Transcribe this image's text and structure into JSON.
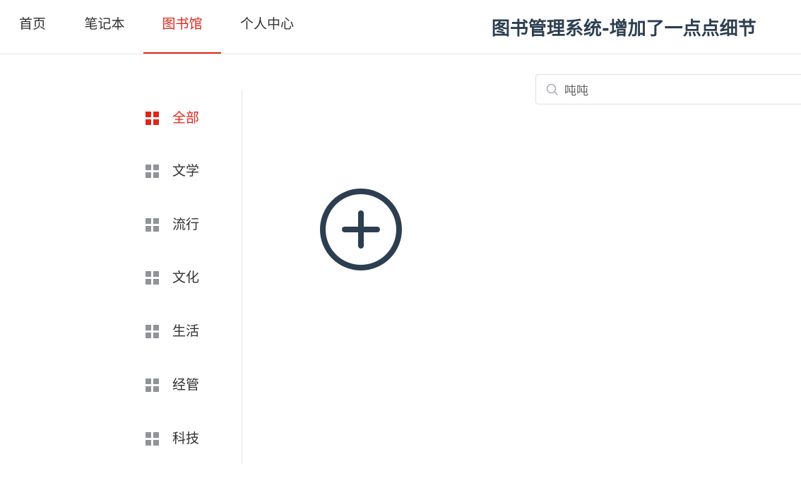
{
  "header": {
    "tabs": [
      {
        "label": "首页"
      },
      {
        "label": "笔记本"
      },
      {
        "label": "图书馆"
      },
      {
        "label": "个人中心"
      }
    ],
    "active_tab": "图书馆",
    "site_title": "图书管理系统-增加了一点点细节"
  },
  "search": {
    "value": "吨吨",
    "icon": "search-icon"
  },
  "sidebar": {
    "items": [
      {
        "label": "全部",
        "icon": "grid-icon"
      },
      {
        "label": "文学",
        "icon": "grid-icon"
      },
      {
        "label": "流行",
        "icon": "grid-icon"
      },
      {
        "label": "文化",
        "icon": "grid-icon"
      },
      {
        "label": "生活",
        "icon": "grid-icon"
      },
      {
        "label": "经管",
        "icon": "grid-icon"
      },
      {
        "label": "科技",
        "icon": "grid-icon"
      }
    ],
    "active_item": "全部"
  },
  "main": {
    "add_icon": "plus-circle-icon"
  },
  "colors": {
    "accent": "#e1251b",
    "title": "#2c3e50",
    "icon_inactive": "#909399",
    "add_icon": "#2c3e50"
  }
}
